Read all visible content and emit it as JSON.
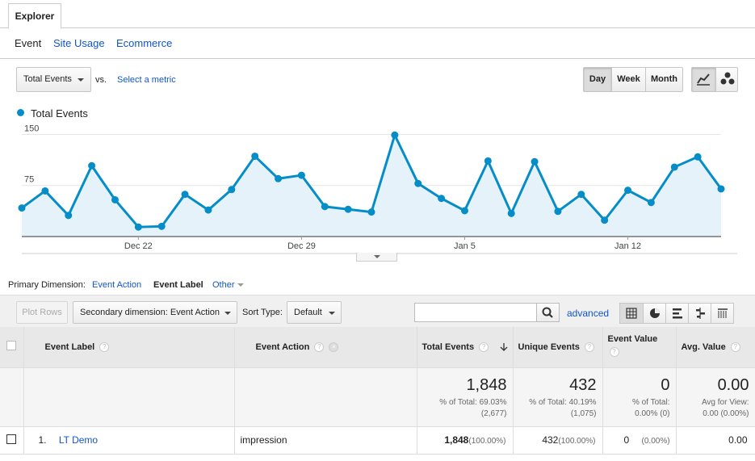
{
  "tabs": {
    "explorer": "Explorer"
  },
  "subtabs": [
    "Event",
    "Site Usage",
    "Ecommerce"
  ],
  "controls": {
    "metric": "Total Events",
    "vs": "vs.",
    "select_metric": "Select a metric",
    "periods": [
      "Day",
      "Week",
      "Month"
    ],
    "active_period": "Day"
  },
  "legend": {
    "label": "Total Events",
    "color": "#058dc7"
  },
  "chart_data": {
    "type": "area",
    "series": [
      {
        "name": "Total Events",
        "color": "#058dc7",
        "values": [
          42,
          67,
          31,
          104,
          54,
          14,
          15,
          62,
          39,
          69,
          118,
          85,
          90,
          44,
          40,
          36,
          149,
          78,
          56,
          38,
          111,
          34,
          110,
          37,
          62,
          24,
          68,
          50,
          102,
          117,
          70
        ]
      }
    ],
    "x_tick_labels": [
      "Dec 22",
      "Dec 29",
      "Jan 5",
      "Jan 12"
    ],
    "x_tick_indices": [
      5,
      12,
      19,
      26
    ],
    "y_tick_labels": [
      "150",
      "75"
    ],
    "y_ticks": [
      150,
      75
    ],
    "ylim": [
      0,
      160
    ],
    "grid": true
  },
  "primary_dimension": {
    "label": "Primary Dimension:",
    "options": [
      "Event Action",
      "Event Label",
      "Other"
    ],
    "active": "Event Label"
  },
  "toolbar": {
    "plot_rows": "Plot Rows",
    "secondary_dimension": "Secondary dimension: Event Action",
    "sort_type_label": "Sort Type:",
    "sort_type": "Default",
    "search_value": "",
    "advanced": "advanced"
  },
  "table": {
    "columns": {
      "event_label": "Event Label",
      "event_action": "Event Action",
      "total_events": "Total Events",
      "unique_events": "Unique Events",
      "event_value": "Event Value",
      "avg_value": "Avg. Value"
    },
    "totals": {
      "total_events": "1,848",
      "total_events_sub1": "% of Total: 69.03%",
      "total_events_sub2": "(2,677)",
      "unique_events": "432",
      "unique_events_sub1": "% of Total: 40.19%",
      "unique_events_sub2": "(1,075)",
      "event_value": "0",
      "event_value_sub1": "% of Total:",
      "event_value_sub2": "0.00% (0)",
      "avg_value": "0.00",
      "avg_value_sub1": "Avg for View:",
      "avg_value_sub2": "0.00 (0.00%)"
    },
    "rows": [
      {
        "index": "1.",
        "event_label": "LT Demo",
        "event_action": "impression",
        "total_events": "1,848",
        "total_events_pct": "(100.00%)",
        "unique_events": "432",
        "unique_events_pct": "(100.00%)",
        "event_value": "0",
        "event_value_pct": "(0.00%)",
        "avg_value": "0.00"
      }
    ]
  }
}
